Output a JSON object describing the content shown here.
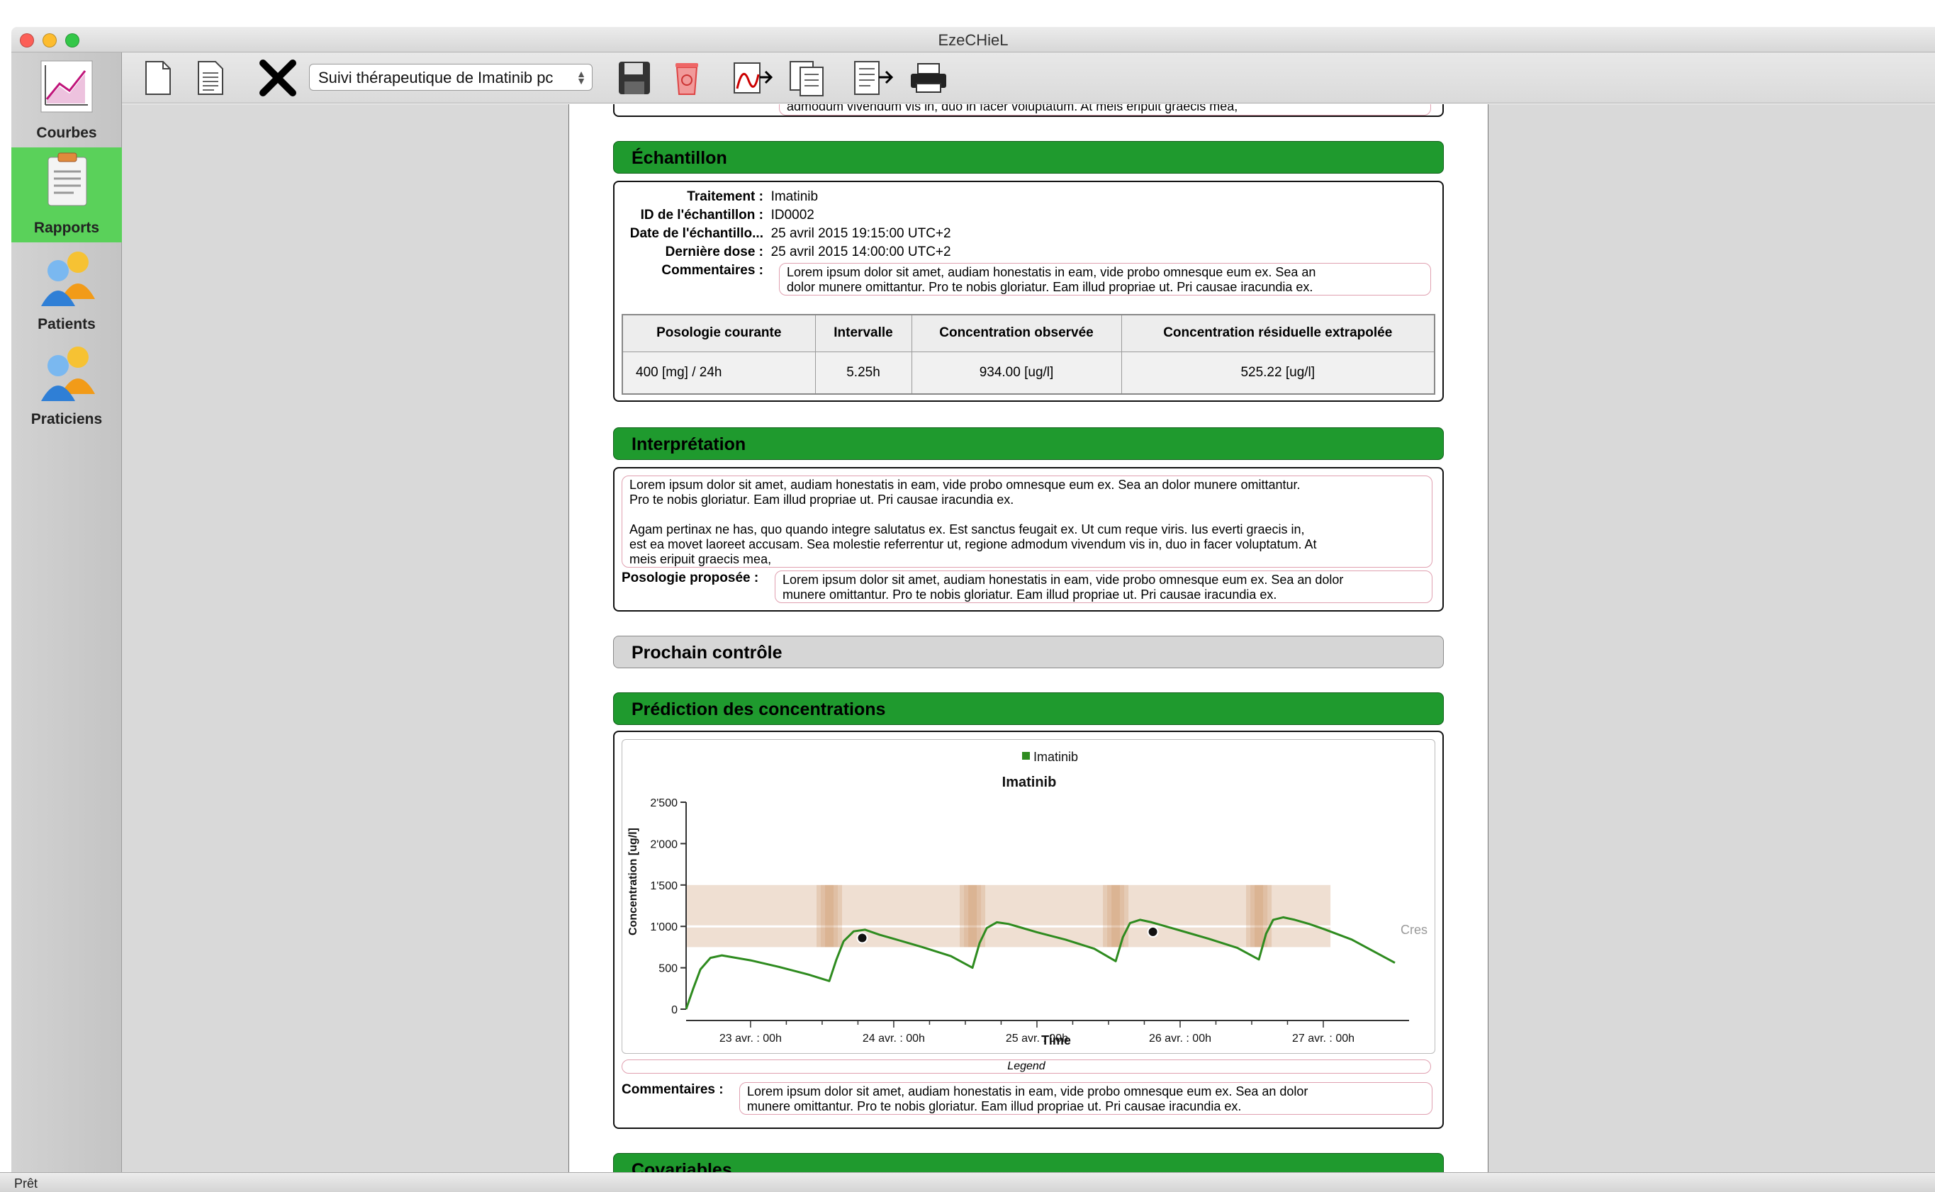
{
  "window": {
    "title": "EzeCHieL"
  },
  "toolbar": {
    "combo_value": "Suivi thérapeutique de Imatinib pc"
  },
  "sidebar": {
    "items": [
      {
        "label": "Courbes"
      },
      {
        "label": "Rapports"
      },
      {
        "label": "Patients"
      },
      {
        "label": "Praticiens"
      }
    ]
  },
  "report": {
    "top_clipped_text": "admodum vivendum vis in, duo in facer voluptatum. At meis eripuit graecis mea,",
    "sample": {
      "header": "Échantillon",
      "fields": [
        {
          "label": "Traitement :",
          "value": "Imatinib"
        },
        {
          "label": "ID de l'échantillon :",
          "value": "ID0002"
        },
        {
          "label": "Date de l'échantillo...",
          "value": "25 avril 2015 19:15:00 UTC+2"
        },
        {
          "label": "Dernière dose :",
          "value": "25 avril 2015 14:00:00 UTC+2"
        }
      ],
      "comment_label": "Commentaires :",
      "comment_line1": "Lorem ipsum dolor sit amet, audiam honestatis in eam, vide probo omnesque eum ex. Sea an",
      "comment_line2": "dolor munere omittantur. Pro te nobis gloriatur. Eam illud propriae ut. Pri causae iracundia ex.",
      "table": {
        "headers": [
          "Posologie courante",
          "Intervalle",
          "Concentration observée",
          "Concentration résiduelle extrapolée"
        ],
        "row": [
          "400 [mg] / 24h",
          "5.25h",
          "934.00 [ug/l]",
          "525.22 [ug/l]"
        ]
      }
    },
    "interpretation": {
      "header": "Interprétation",
      "lines": [
        "Lorem ipsum dolor sit amet, audiam honestatis in eam, vide probo omnesque eum ex. Sea an dolor munere omittantur.",
        "Pro te nobis gloriatur. Eam illud propriae ut. Pri causae iracundia ex.",
        "",
        "Agam pertinax ne has, quo quando integre salutatus ex. Est sanctus feugait ex. Ut cum reque viris. Ius everti graecis in,",
        "est ea movet laoreet accusam. Sea molestie referrentur ut, regione admodum vivendum vis in, duo in facer voluptatum. At",
        "meis eripuit graecis mea,"
      ],
      "posology_label": "Posologie proposée :",
      "posology_line1": "Lorem ipsum dolor sit amet, audiam honestatis in eam, vide probo omnesque eum ex. Sea an dolor",
      "posology_line2": "munere omittantur. Pro te nobis gloriatur. Eam illud propriae ut. Pri causae iracundia ex."
    },
    "next_control": {
      "header": "Prochain contrôle"
    },
    "prediction": {
      "header": "Prédiction des concentrations",
      "legend_box": "Legend",
      "cut_label": "Cres",
      "comment_label": "Commentaires :",
      "comment_line1": "Lorem ipsum dolor sit amet, audiam honestatis in eam, vide probo omnesque eum ex. Sea an dolor",
      "comment_line2": "munere omittantur. Pro te nobis gloriatur. Eam illud propriae ut. Pri causae iracundia ex."
    },
    "covariates": {
      "header": "Covariables"
    }
  },
  "status": {
    "text": "Prêt"
  },
  "colors": {
    "accent_green": "#1f9a2e",
    "sidebar_active": "#5ad15a",
    "curve": "#2e8b1f",
    "band": "#efdfd2"
  },
  "chart_data": {
    "type": "line",
    "title": "Imatinib",
    "legend": [
      "Imatinib"
    ],
    "legend_position": "top-center",
    "xlabel": "Time",
    "ylabel": "Concentration [ug/l]",
    "x_unit": "day",
    "xlim": [
      22.55,
      27.5
    ],
    "ylim": [
      0,
      2500
    ],
    "yticks": [
      0,
      500,
      1000,
      1500,
      2000,
      2500
    ],
    "ytick_labels": [
      "0",
      "500",
      "1'000",
      "1'500",
      "2'000",
      "2'500"
    ],
    "xticks": [
      23,
      24,
      25,
      26,
      27
    ],
    "xtick_labels": [
      "23 avr. : 00h",
      "24 avr. : 00h",
      "25 avr. : 00h",
      "26 avr. : 00h",
      "27 avr. : 00h"
    ],
    "series": [
      {
        "name": "Imatinib",
        "x": [
          22.55,
          22.6,
          22.65,
          22.72,
          22.8,
          22.9,
          23.0,
          23.2,
          23.4,
          23.55,
          23.6,
          23.65,
          23.72,
          23.8,
          23.9,
          24.0,
          24.2,
          24.4,
          24.55,
          24.6,
          24.65,
          24.72,
          24.8,
          24.9,
          25.0,
          25.2,
          25.4,
          25.55,
          25.6,
          25.65,
          25.72,
          25.8,
          25.9,
          26.0,
          26.2,
          26.4,
          26.55,
          26.6,
          26.65,
          26.72,
          26.8,
          26.9,
          27.0,
          27.2,
          27.5
        ],
        "y": [
          0,
          250,
          480,
          620,
          650,
          620,
          590,
          510,
          420,
          340,
          600,
          820,
          940,
          960,
          900,
          850,
          750,
          640,
          500,
          800,
          980,
          1050,
          1030,
          980,
          930,
          840,
          730,
          580,
          870,
          1040,
          1080,
          1050,
          1000,
          950,
          850,
          740,
          600,
          910,
          1080,
          1110,
          1080,
          1030,
          970,
          840,
          560
        ]
      }
    ],
    "observations": [
      {
        "x": 23.78,
        "y": 860
      },
      {
        "x": 25.81,
        "y": 934
      }
    ],
    "target_band": {
      "low": 750,
      "high": 1500,
      "x_end": 27.05
    },
    "target_line": 1000,
    "grid": false
  }
}
